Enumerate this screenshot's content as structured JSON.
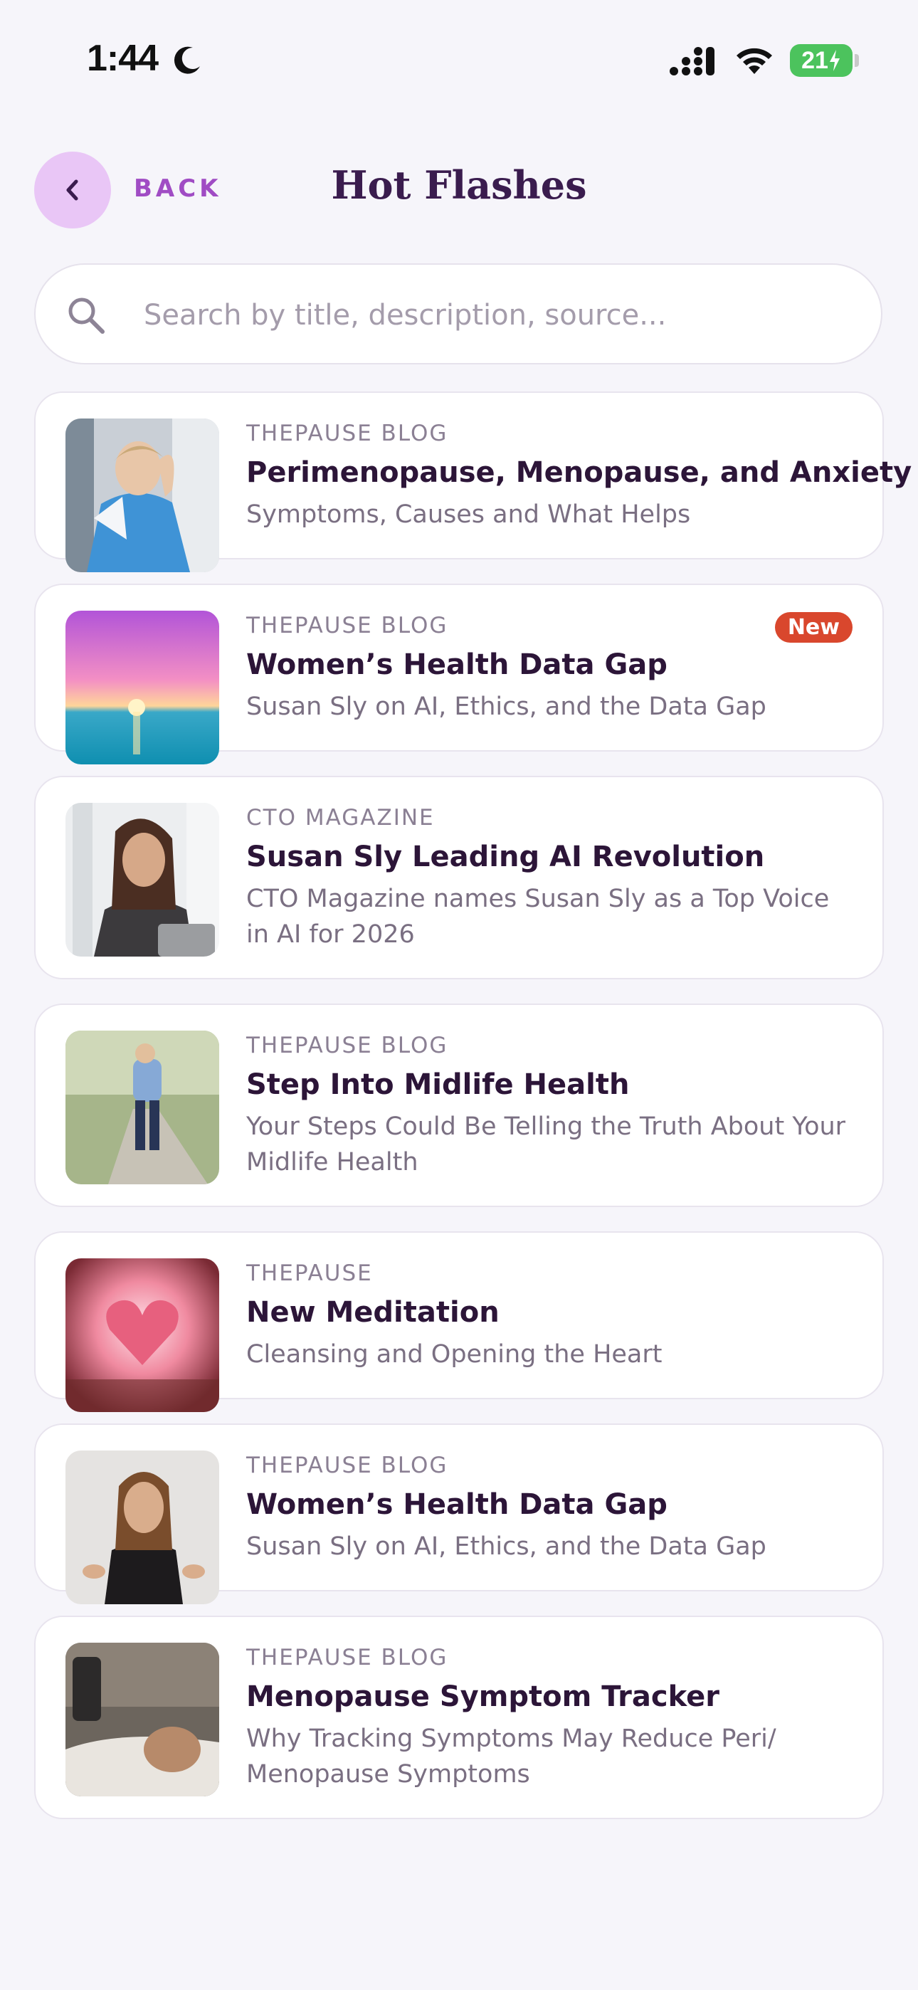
{
  "status_bar": {
    "time": "1:44",
    "battery": "21"
  },
  "header": {
    "back_label": "BACK",
    "title": "Hot Flashes"
  },
  "search": {
    "placeholder": "Search by title, description, source..."
  },
  "articles": [
    {
      "source": "THEPAUSE BLOG",
      "title": "Perimenopause, Menopause, and Anxiety",
      "description": "Symptoms, Causes and What Helps",
      "badge": ""
    },
    {
      "source": "THEPAUSE BLOG",
      "title": "Women’s Health Data Gap",
      "description": "Susan Sly on AI, Ethics, and the Data Gap",
      "badge": "New"
    },
    {
      "source": "CTO MAGAZINE",
      "title": "Susan Sly Leading AI Revolution",
      "description": "CTO Magazine names Susan Sly as a Top Voice in AI for 2026",
      "badge": ""
    },
    {
      "source": "THEPAUSE BLOG",
      "title": "Step Into Midlife Health",
      "description": "Your Steps Could Be Telling the Truth About Your Midlife Health",
      "badge": ""
    },
    {
      "source": "THEPAUSE",
      "title": "New Meditation",
      "description": "Cleansing and Opening the Heart",
      "badge": ""
    },
    {
      "source": "THEPAUSE BLOG",
      "title": "Women’s Health Data Gap",
      "description": "Susan Sly on AI, Ethics, and the Data Gap",
      "badge": ""
    },
    {
      "source": "THEPAUSE BLOG",
      "title": "Menopause Symptom Tracker",
      "description": "Why Tracking Symptoms May Reduce Peri/ Menopause Symptoms",
      "badge": ""
    }
  ]
}
